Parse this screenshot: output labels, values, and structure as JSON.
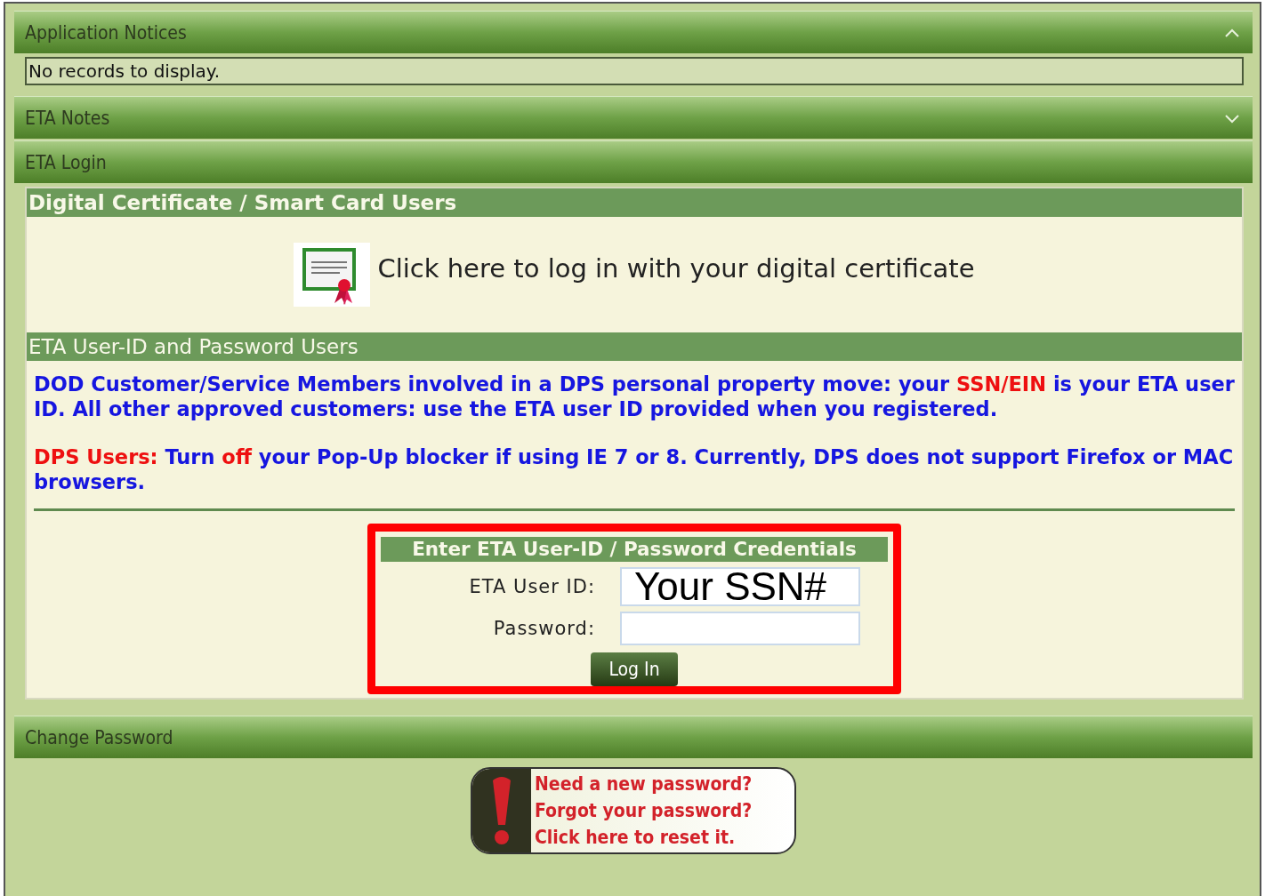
{
  "notices": {
    "title": "Application Notices",
    "expanded": true,
    "message": "No records to display."
  },
  "eta_notes": {
    "title": "ETA Notes",
    "expanded": false
  },
  "eta_login": {
    "title": "ETA Login",
    "certificate": {
      "heading": "Digital Certificate / Smart Card Users",
      "link": "Click here to log in with your digital certificate"
    },
    "userid": {
      "heading": "ETA User-ID and Password Users",
      "paragraphs": [
        "DOD Customer/Service Members involved in a DPS personal property move: your *SSN/EIN* is your ETA user ID. All other approved customers: use the ETA user ID provided when you registered.",
        "*DPS Users:* Turn *off* your Pop-Up blocker if using IE 7 or 8. Currently, DPS does not support Firefox or MAC browsers."
      ]
    },
    "credentials": {
      "heading": "Enter ETA User-ID / Password Credentials",
      "user_label": "ETA User ID:",
      "user_value": "Your SSN#",
      "password_label": "Password:",
      "button": "Log In"
    }
  },
  "change_password": {
    "title": "Change Password",
    "banner": [
      "Need a new password?",
      "Forgot your password?",
      "Click here to reset it."
    ]
  }
}
